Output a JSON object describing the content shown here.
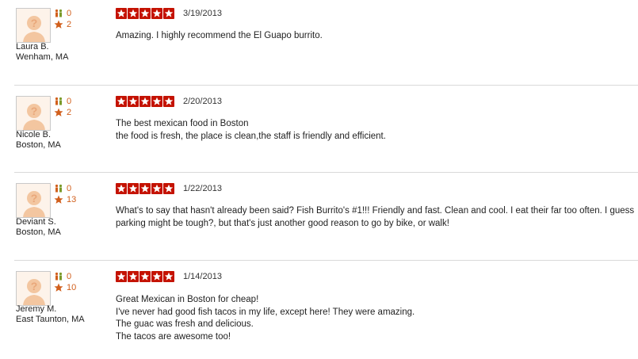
{
  "reviews": [
    {
      "user_name": "Laura B.",
      "user_location": "Wenham, MA",
      "friends_count": "0",
      "reviews_count": "2",
      "rating": 5,
      "date": "3/19/2013",
      "text_lines": [
        "Amazing. I highly recommend the El Guapo burrito."
      ]
    },
    {
      "user_name": "Nicole B.",
      "user_location": "Boston, MA",
      "friends_count": "0",
      "reviews_count": "2",
      "rating": 5,
      "date": "2/20/2013",
      "text_lines": [
        "The best mexican food in Boston",
        "the food is fresh, the place is clean,the staff is friendly and efficient."
      ]
    },
    {
      "user_name": "Deviant S.",
      "user_location": "Boston, MA",
      "friends_count": "0",
      "reviews_count": "13",
      "rating": 5,
      "date": "1/22/2013",
      "text_lines": [
        "What's to say that hasn't already been said? Fish Burrito's #1!!! Friendly and fast. Clean and cool. I eat their far too often. I guess parking might be tough?, but that's just another good reason to go by bike, or walk!"
      ]
    },
    {
      "user_name": "Jeremy M.",
      "user_location": "East Taunton, MA",
      "friends_count": "0",
      "reviews_count": "10",
      "rating": 5,
      "date": "1/14/2013",
      "text_lines": [
        "Great Mexican in Boston for cheap!",
        "I've never had good fish tacos in my life, except here! They were amazing.",
        "The guac was fresh and delicious.",
        "The tacos are awesome too!"
      ]
    }
  ],
  "colors": {
    "star_bg": "#c41200",
    "count_orange": "#d15f1c",
    "divider": "#d9d9d9"
  },
  "icons": {
    "avatar": "default-user-silhouette-icon",
    "friends": "friends-icon",
    "reviews": "star-icon",
    "rating_star": "rating-star-icon"
  }
}
